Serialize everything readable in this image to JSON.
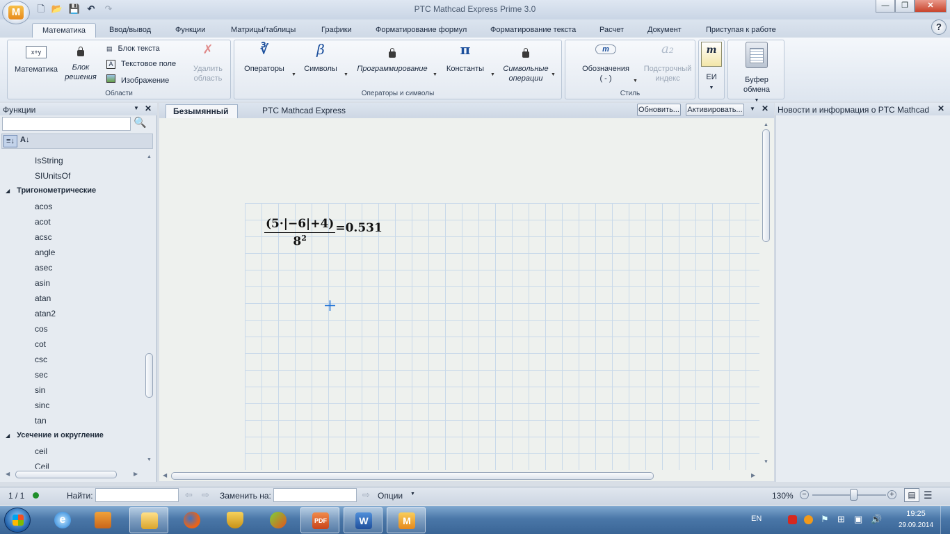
{
  "app": {
    "title": "PTC Mathcad Express Prime 3.0",
    "logo_letter": "M"
  },
  "window_controls": {
    "minimize": "—",
    "maximize": "❐",
    "close": "✕"
  },
  "ribbon_tabs": [
    "Математика",
    "Ввод/вывод",
    "Функции",
    "Матрицы/таблицы",
    "Графики",
    "Форматирование формул",
    "Форматирование текста",
    "Расчет",
    "Документ",
    "Приступая к работе"
  ],
  "help": "?",
  "groups": {
    "regions": {
      "label": "Области",
      "math": "Математика",
      "math_icon_text": "x+y",
      "solve_block_1": "Блок",
      "solve_block_2": "решения",
      "text_block": "Блок текста",
      "text_box": "Текстовое поле",
      "image": "Изображение",
      "delete_1": "Удалить",
      "delete_2": "область"
    },
    "operators": {
      "label": "Операторы и символы",
      "operators": "Операторы",
      "operators_icon": "∛",
      "symbols": "Символы",
      "symbols_icon": "β",
      "programming": "Программирование",
      "constants": "Константы",
      "constants_icon": "π",
      "symbolic_1": "Символьные",
      "symbolic_2": "операции"
    },
    "style": {
      "label": "Стиль",
      "labels": "Обозначения",
      "labels_value": "( - )",
      "labels_icon": "m",
      "subscript_1": "Подстрочный",
      "subscript_2": "индекс",
      "subscript_icon": "a₂"
    },
    "units": {
      "label": "ЕИ",
      "icon": "m"
    },
    "clipboard": {
      "label": "Буфер обмена"
    }
  },
  "functions_panel": {
    "title": "Функции",
    "items": [
      {
        "kind": "item",
        "text": "IsString"
      },
      {
        "kind": "item",
        "text": "SIUnitsOf"
      },
      {
        "kind": "cat",
        "text": "Тригонометрические"
      },
      {
        "kind": "item",
        "text": "acos"
      },
      {
        "kind": "item",
        "text": "acot"
      },
      {
        "kind": "item",
        "text": "acsc"
      },
      {
        "kind": "item",
        "text": "angle"
      },
      {
        "kind": "item",
        "text": "asec"
      },
      {
        "kind": "item",
        "text": "asin"
      },
      {
        "kind": "item",
        "text": "atan"
      },
      {
        "kind": "item",
        "text": "atan2"
      },
      {
        "kind": "item",
        "text": "cos"
      },
      {
        "kind": "item",
        "text": "cot"
      },
      {
        "kind": "item",
        "text": "csc"
      },
      {
        "kind": "item",
        "text": "sec"
      },
      {
        "kind": "item",
        "text": "sin"
      },
      {
        "kind": "item",
        "text": "sinc"
      },
      {
        "kind": "item",
        "text": "tan"
      },
      {
        "kind": "cat",
        "text": "Усечение и округление"
      },
      {
        "kind": "item",
        "text": "ceil"
      },
      {
        "kind": "item",
        "text": "Ceil"
      }
    ]
  },
  "doc_tabs": {
    "active": "Безымянный",
    "other": "PTC Mathcad Express"
  },
  "doc_buttons": {
    "update": "Обновить...",
    "activate": "Активировать..."
  },
  "formula": {
    "numerator": "(5·|−6|+4)",
    "denominator_base": "8",
    "denominator_exp": "2",
    "result": "=0.531"
  },
  "news_panel": {
    "title": "Новости и информация о PTC Mathcad"
  },
  "status": {
    "page": "1 / 1",
    "find_label": "Найти:",
    "replace_label": "Заменить на:",
    "options": "Опции",
    "zoom": "130%"
  },
  "taskbar": {
    "lang": "EN",
    "time": "19:25",
    "date": "29.09.2014",
    "pdf_text": "PDF",
    "word_text": "W",
    "mathcad_text": "M"
  },
  "colors": {
    "accent": "#1a6fd6",
    "grid": "#c8d9ea",
    "taskbar": "#3a6596"
  }
}
